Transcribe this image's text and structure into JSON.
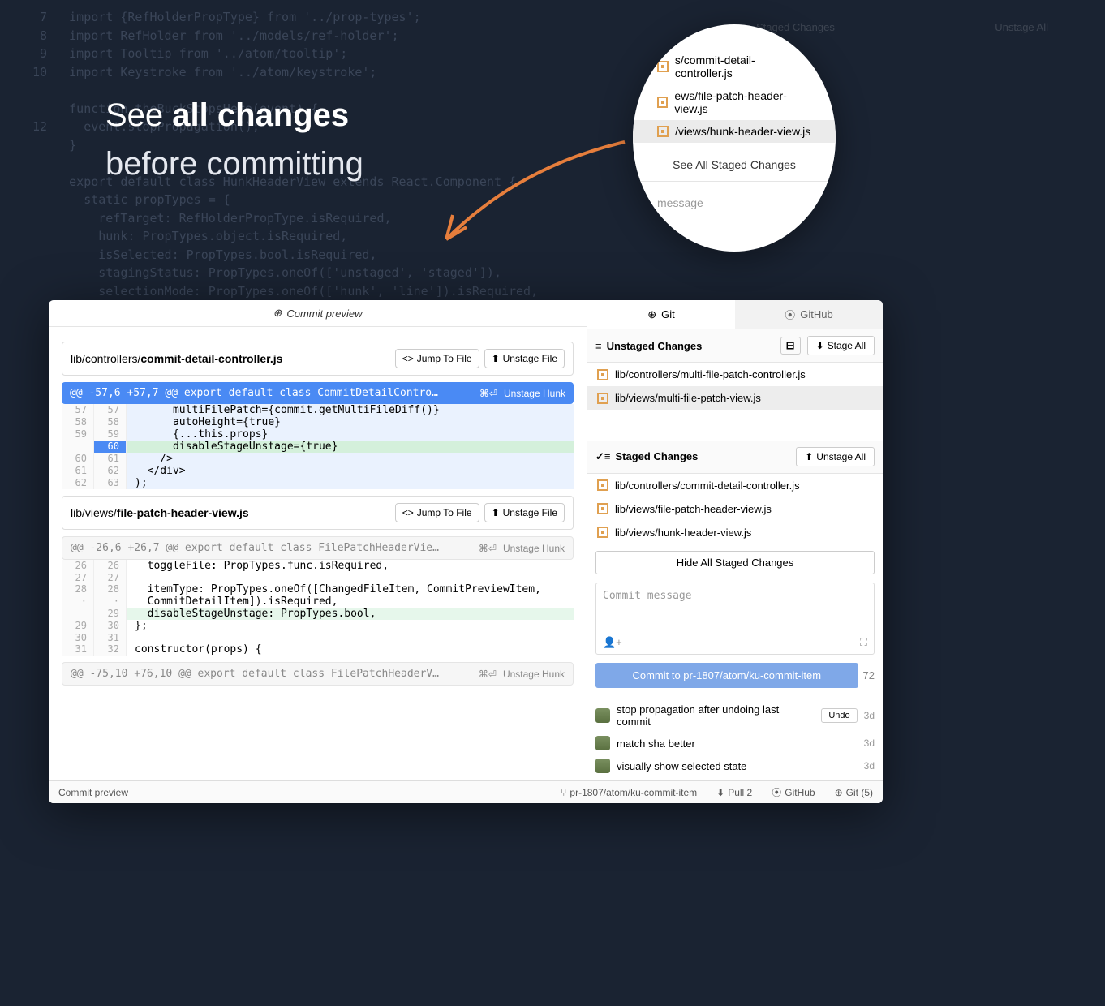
{
  "headline": {
    "line1a": "See",
    "line1b": "all changes",
    "line2": "before committing"
  },
  "bg_code": {
    "text": " 7   import {RefHolderPropType} from '../prop-types';\n 8   import RefHolder from '../models/ref-holder';\n 9   import Tooltip from '../atom/tooltip';\n10   import Keystroke from '../atom/keystroke';\n\n     function theBuckStopsHere(event) {\n12     event.stopPropagation();\n     }\n\n     export default class HunkHeaderView extends React.Component {\n       static propTypes = {\n         refTarget: RefHolderPropType.isRequired,\n         hunk: PropTypes.object.isRequired,\n         isSelected: PropTypes.bool.isRequired,\n         stagingStatus: PropTypes.oneOf(['unstaged', 'staged']),\n         selectionMode: PropTypes.oneOf(['hunk', 'line']).isRequired,\n         toggleSelectionLabel: PropTypes.string,"
  },
  "magnifier": {
    "files": [
      {
        "name": "s/commit-detail-controller.js",
        "sel": false
      },
      {
        "name": "ews/file-patch-header-view.js",
        "sel": false
      },
      {
        "name": "/views/hunk-header-view.js",
        "sel": true
      }
    ],
    "button": "See All Staged Changes",
    "commit_placeholder": "message"
  },
  "faded_panel": {
    "title": "Staged Changes",
    "action": "Unstage All",
    "files": []
  },
  "app": {
    "commit_preview_title": "Commit preview",
    "files": [
      {
        "path_prefix": "lib/controllers/",
        "path_bold": "commit-detail-controller.js",
        "jump": "Jump To File",
        "unstage_file": "Unstage File",
        "blue_header": true,
        "hunk_header": "@@ -57,6 +57,7 @@ export default class CommitDetailContro…",
        "hunk_key": "⌘⏎",
        "hunk_btn": "Unstage Hunk",
        "lines": [
          {
            "o": "57",
            "n": "57",
            "t": "ctx",
            "c": "      multiFilePatch={commit.getMultiFileDiff()}"
          },
          {
            "o": "58",
            "n": "58",
            "t": "ctx",
            "c": "      autoHeight={true}"
          },
          {
            "o": "59",
            "n": "59",
            "t": "ctx",
            "c": "      {...this.props}"
          },
          {
            "o": "",
            "n": "60",
            "t": "add",
            "sel": true,
            "c": "      disableStageUnstage={true}"
          },
          {
            "o": "60",
            "n": "61",
            "t": "ctx",
            "c": "    />"
          },
          {
            "o": "61",
            "n": "62",
            "t": "ctx",
            "c": "  </div>"
          },
          {
            "o": "62",
            "n": "63",
            "t": "ctx",
            "c": ");"
          }
        ]
      },
      {
        "path_prefix": "lib/views/",
        "path_bold": "file-patch-header-view.js",
        "jump": "Jump To File",
        "unstage_file": "Unstage File",
        "blue_header": false,
        "hunk_header": "@@ -26,6 +26,7 @@ export default class FilePatchHeaderVie…",
        "hunk_key": "⌘⏎",
        "hunk_btn": "Unstage Hunk",
        "lines": [
          {
            "o": "26",
            "n": "26",
            "t": "plain",
            "c": "  toggleFile: PropTypes.func.isRequired,"
          },
          {
            "o": "27",
            "n": "27",
            "t": "plain",
            "c": ""
          },
          {
            "o": "28",
            "n": "28",
            "t": "plain",
            "c": "  itemType: PropTypes.oneOf([ChangedFileItem, CommitPreviewItem,"
          },
          {
            "o": "·",
            "n": "·",
            "t": "plain",
            "c": "  CommitDetailItem]).isRequired,"
          },
          {
            "o": "",
            "n": "29",
            "t": "addlight",
            "c": "  disableStageUnstage: PropTypes.bool,"
          },
          {
            "o": "29",
            "n": "30",
            "t": "plain",
            "c": "};"
          },
          {
            "o": "30",
            "n": "31",
            "t": "plain",
            "c": ""
          },
          {
            "o": "31",
            "n": "32",
            "t": "plain",
            "c": "constructor(props) {"
          }
        ],
        "trailing_hunk": {
          "header": "@@ -75,10 +76,10 @@ export default class FilePatchHeaderV…",
          "key": "⌘⏎",
          "btn": "Unstage Hunk"
        }
      }
    ],
    "right": {
      "tabs": {
        "git": "Git",
        "github": "GitHub"
      },
      "unstaged": {
        "title": "Unstaged Changes",
        "action": "Stage All",
        "files": [
          {
            "name": "lib/controllers/multi-file-patch-controller.js",
            "sel": false
          },
          {
            "name": "lib/views/multi-file-patch-view.js",
            "sel": true
          }
        ]
      },
      "staged": {
        "title": "Staged Changes",
        "action": "Unstage All",
        "files": [
          {
            "name": "lib/controllers/commit-detail-controller.js"
          },
          {
            "name": "lib/views/file-patch-header-view.js"
          },
          {
            "name": "lib/views/hunk-header-view.js"
          }
        ]
      },
      "hide_staged_btn": "Hide All Staged Changes",
      "commit_placeholder": "Commit message",
      "commit_btn": "Commit to pr-1807/atom/ku-commit-item",
      "commit_count": "72",
      "recent": [
        {
          "msg": "stop propagation after undoing last commit",
          "undo": "Undo",
          "time": "3d"
        },
        {
          "msg": "match sha better",
          "time": "3d"
        },
        {
          "msg": "visually show selected state",
          "time": "3d"
        }
      ]
    },
    "status_bar": {
      "left": "Commit preview",
      "branch": "pr-1807/atom/ku-commit-item",
      "pull": "Pull 2",
      "github": "GitHub",
      "git": "Git (5)"
    }
  }
}
